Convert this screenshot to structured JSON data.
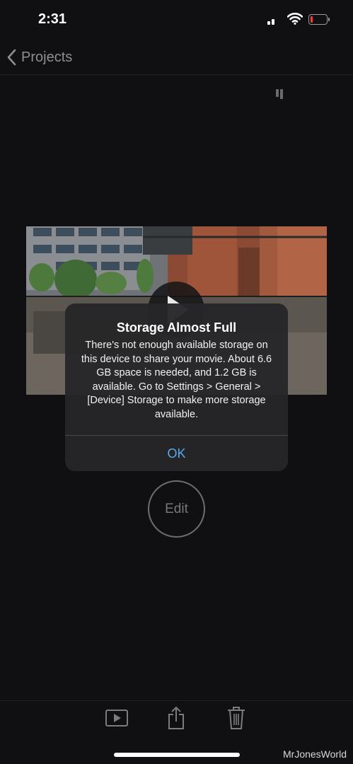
{
  "status_bar": {
    "time": "2:31",
    "icons": [
      "cellular-signal-icon",
      "wifi-icon",
      "battery-low-icon"
    ],
    "battery_color": "#ff3b30"
  },
  "nav": {
    "back_label": "Projects",
    "back_icon": "chevron-left-icon"
  },
  "video": {
    "play_icon": "play-icon"
  },
  "alert": {
    "title": "Storage Almost Full",
    "message": "There's not enough available storage on this device to share your movie. About 6.6 GB space is needed, and 1.2 GB is available. Go to Settings > General > [Device] Storage to make more storage available.",
    "ok_label": "OK",
    "ok_color": "#5aa9ee"
  },
  "edit": {
    "label": "Edit"
  },
  "toolbar": {
    "icons": [
      "play-preview-icon",
      "share-icon",
      "trash-icon"
    ]
  },
  "watermark": "MrJonesWorld"
}
